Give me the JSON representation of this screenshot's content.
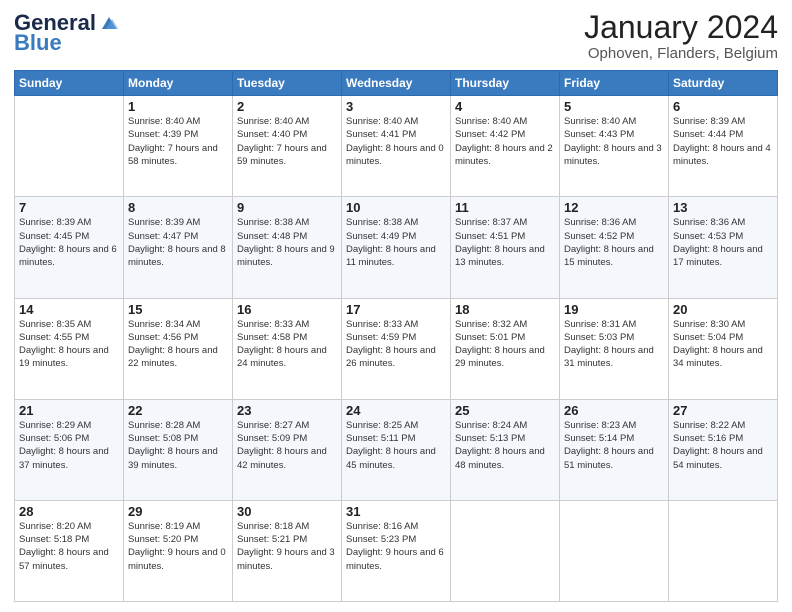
{
  "header": {
    "logo_general": "General",
    "logo_blue": "Blue",
    "month_title": "January 2024",
    "location": "Ophoven, Flanders, Belgium"
  },
  "days_of_week": [
    "Sunday",
    "Monday",
    "Tuesday",
    "Wednesday",
    "Thursday",
    "Friday",
    "Saturday"
  ],
  "weeks": [
    [
      {
        "day": "",
        "sunrise": "",
        "sunset": "",
        "daylight": ""
      },
      {
        "day": "1",
        "sunrise": "Sunrise: 8:40 AM",
        "sunset": "Sunset: 4:39 PM",
        "daylight": "Daylight: 7 hours and 58 minutes."
      },
      {
        "day": "2",
        "sunrise": "Sunrise: 8:40 AM",
        "sunset": "Sunset: 4:40 PM",
        "daylight": "Daylight: 7 hours and 59 minutes."
      },
      {
        "day": "3",
        "sunrise": "Sunrise: 8:40 AM",
        "sunset": "Sunset: 4:41 PM",
        "daylight": "Daylight: 8 hours and 0 minutes."
      },
      {
        "day": "4",
        "sunrise": "Sunrise: 8:40 AM",
        "sunset": "Sunset: 4:42 PM",
        "daylight": "Daylight: 8 hours and 2 minutes."
      },
      {
        "day": "5",
        "sunrise": "Sunrise: 8:40 AM",
        "sunset": "Sunset: 4:43 PM",
        "daylight": "Daylight: 8 hours and 3 minutes."
      },
      {
        "day": "6",
        "sunrise": "Sunrise: 8:39 AM",
        "sunset": "Sunset: 4:44 PM",
        "daylight": "Daylight: 8 hours and 4 minutes."
      }
    ],
    [
      {
        "day": "7",
        "sunrise": "Sunrise: 8:39 AM",
        "sunset": "Sunset: 4:45 PM",
        "daylight": "Daylight: 8 hours and 6 minutes."
      },
      {
        "day": "8",
        "sunrise": "Sunrise: 8:39 AM",
        "sunset": "Sunset: 4:47 PM",
        "daylight": "Daylight: 8 hours and 8 minutes."
      },
      {
        "day": "9",
        "sunrise": "Sunrise: 8:38 AM",
        "sunset": "Sunset: 4:48 PM",
        "daylight": "Daylight: 8 hours and 9 minutes."
      },
      {
        "day": "10",
        "sunrise": "Sunrise: 8:38 AM",
        "sunset": "Sunset: 4:49 PM",
        "daylight": "Daylight: 8 hours and 11 minutes."
      },
      {
        "day": "11",
        "sunrise": "Sunrise: 8:37 AM",
        "sunset": "Sunset: 4:51 PM",
        "daylight": "Daylight: 8 hours and 13 minutes."
      },
      {
        "day": "12",
        "sunrise": "Sunrise: 8:36 AM",
        "sunset": "Sunset: 4:52 PM",
        "daylight": "Daylight: 8 hours and 15 minutes."
      },
      {
        "day": "13",
        "sunrise": "Sunrise: 8:36 AM",
        "sunset": "Sunset: 4:53 PM",
        "daylight": "Daylight: 8 hours and 17 minutes."
      }
    ],
    [
      {
        "day": "14",
        "sunrise": "Sunrise: 8:35 AM",
        "sunset": "Sunset: 4:55 PM",
        "daylight": "Daylight: 8 hours and 19 minutes."
      },
      {
        "day": "15",
        "sunrise": "Sunrise: 8:34 AM",
        "sunset": "Sunset: 4:56 PM",
        "daylight": "Daylight: 8 hours and 22 minutes."
      },
      {
        "day": "16",
        "sunrise": "Sunrise: 8:33 AM",
        "sunset": "Sunset: 4:58 PM",
        "daylight": "Daylight: 8 hours and 24 minutes."
      },
      {
        "day": "17",
        "sunrise": "Sunrise: 8:33 AM",
        "sunset": "Sunset: 4:59 PM",
        "daylight": "Daylight: 8 hours and 26 minutes."
      },
      {
        "day": "18",
        "sunrise": "Sunrise: 8:32 AM",
        "sunset": "Sunset: 5:01 PM",
        "daylight": "Daylight: 8 hours and 29 minutes."
      },
      {
        "day": "19",
        "sunrise": "Sunrise: 8:31 AM",
        "sunset": "Sunset: 5:03 PM",
        "daylight": "Daylight: 8 hours and 31 minutes."
      },
      {
        "day": "20",
        "sunrise": "Sunrise: 8:30 AM",
        "sunset": "Sunset: 5:04 PM",
        "daylight": "Daylight: 8 hours and 34 minutes."
      }
    ],
    [
      {
        "day": "21",
        "sunrise": "Sunrise: 8:29 AM",
        "sunset": "Sunset: 5:06 PM",
        "daylight": "Daylight: 8 hours and 37 minutes."
      },
      {
        "day": "22",
        "sunrise": "Sunrise: 8:28 AM",
        "sunset": "Sunset: 5:08 PM",
        "daylight": "Daylight: 8 hours and 39 minutes."
      },
      {
        "day": "23",
        "sunrise": "Sunrise: 8:27 AM",
        "sunset": "Sunset: 5:09 PM",
        "daylight": "Daylight: 8 hours and 42 minutes."
      },
      {
        "day": "24",
        "sunrise": "Sunrise: 8:25 AM",
        "sunset": "Sunset: 5:11 PM",
        "daylight": "Daylight: 8 hours and 45 minutes."
      },
      {
        "day": "25",
        "sunrise": "Sunrise: 8:24 AM",
        "sunset": "Sunset: 5:13 PM",
        "daylight": "Daylight: 8 hours and 48 minutes."
      },
      {
        "day": "26",
        "sunrise": "Sunrise: 8:23 AM",
        "sunset": "Sunset: 5:14 PM",
        "daylight": "Daylight: 8 hours and 51 minutes."
      },
      {
        "day": "27",
        "sunrise": "Sunrise: 8:22 AM",
        "sunset": "Sunset: 5:16 PM",
        "daylight": "Daylight: 8 hours and 54 minutes."
      }
    ],
    [
      {
        "day": "28",
        "sunrise": "Sunrise: 8:20 AM",
        "sunset": "Sunset: 5:18 PM",
        "daylight": "Daylight: 8 hours and 57 minutes."
      },
      {
        "day": "29",
        "sunrise": "Sunrise: 8:19 AM",
        "sunset": "Sunset: 5:20 PM",
        "daylight": "Daylight: 9 hours and 0 minutes."
      },
      {
        "day": "30",
        "sunrise": "Sunrise: 8:18 AM",
        "sunset": "Sunset: 5:21 PM",
        "daylight": "Daylight: 9 hours and 3 minutes."
      },
      {
        "day": "31",
        "sunrise": "Sunrise: 8:16 AM",
        "sunset": "Sunset: 5:23 PM",
        "daylight": "Daylight: 9 hours and 6 minutes."
      },
      {
        "day": "",
        "sunrise": "",
        "sunset": "",
        "daylight": ""
      },
      {
        "day": "",
        "sunrise": "",
        "sunset": "",
        "daylight": ""
      },
      {
        "day": "",
        "sunrise": "",
        "sunset": "",
        "daylight": ""
      }
    ]
  ]
}
